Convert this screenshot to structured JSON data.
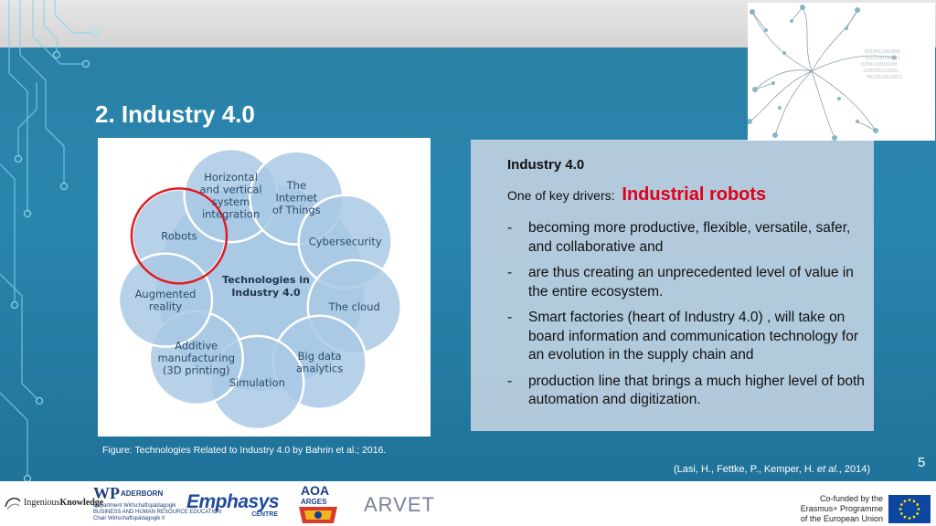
{
  "slide": {
    "title": "2. Industry 4.0",
    "page_number": "5"
  },
  "figure": {
    "center_label": [
      "Technologies in",
      "Industry 4.0"
    ],
    "nodes": [
      {
        "label": [
          "Robots"
        ],
        "highlighted": true
      },
      {
        "label": [
          "Horizontal",
          "and vertical",
          "system",
          "integration"
        ]
      },
      {
        "label": [
          "The",
          "Internet",
          "of Things"
        ]
      },
      {
        "label": [
          "Cybersecurity"
        ]
      },
      {
        "label": [
          "The cloud"
        ]
      },
      {
        "label": [
          "Big data",
          "analytics"
        ]
      },
      {
        "label": [
          "Simulation"
        ]
      },
      {
        "label": [
          "Additive",
          "manufacturing",
          "(3D printing)"
        ]
      },
      {
        "label": [
          "Augmented",
          "reality"
        ]
      }
    ],
    "caption": "Figure: Technologies Related to Industry 4.0 by Bahrin et al.; 2016."
  },
  "textbox": {
    "heading": "Industry 4.0",
    "drivers_prefix": "One of key drivers:",
    "drivers_highlight": "Industrial robots",
    "bullets": [
      "becoming more productive, flexible, versatile, safer, and collaborative and",
      "are thus creating an unprecedented level of value in the entire ecosystem.",
      "Smart factories (heart of Industry 4.0) , will take on board information and communication technology for an evolution in the supply chain and",
      "production line that brings a much higher level of both automation and digitization."
    ]
  },
  "citation": {
    "before": "(Lasi, H., Fettke, P., Kemper, H. ",
    "italic": "et al.",
    "after": ", 2014)"
  },
  "logos": {
    "ingenious": {
      "light": "Ingenious",
      "bold": "Knowledge"
    },
    "wp": {
      "mark": "WP",
      "name": "ADERBORN",
      "dept": "Department Wirtschaftspädagogik",
      "line": "BUSINESS AND HUMAN RESOURCE EDUCATION",
      "chair": "Chair Wirtschaftspädagogik II"
    },
    "emphasys": {
      "main": "Emphasys",
      "sub": "CENTRE"
    },
    "aoa": {
      "main": "AOA",
      "sub": "ARGES"
    },
    "arvet": "ARVET",
    "eu": [
      "Co-funded by the",
      "Erasmus+ Programme",
      "of the European Union"
    ]
  },
  "colors": {
    "slide_bg": "#2a86ae",
    "node_fill": "#a9c9e4",
    "node_stroke": "#ffffff",
    "highlight_ring": "#e21b23",
    "highlight_text": "#e0001a",
    "eu_blue": "#0e47a1",
    "eu_star": "#ffdd00"
  }
}
